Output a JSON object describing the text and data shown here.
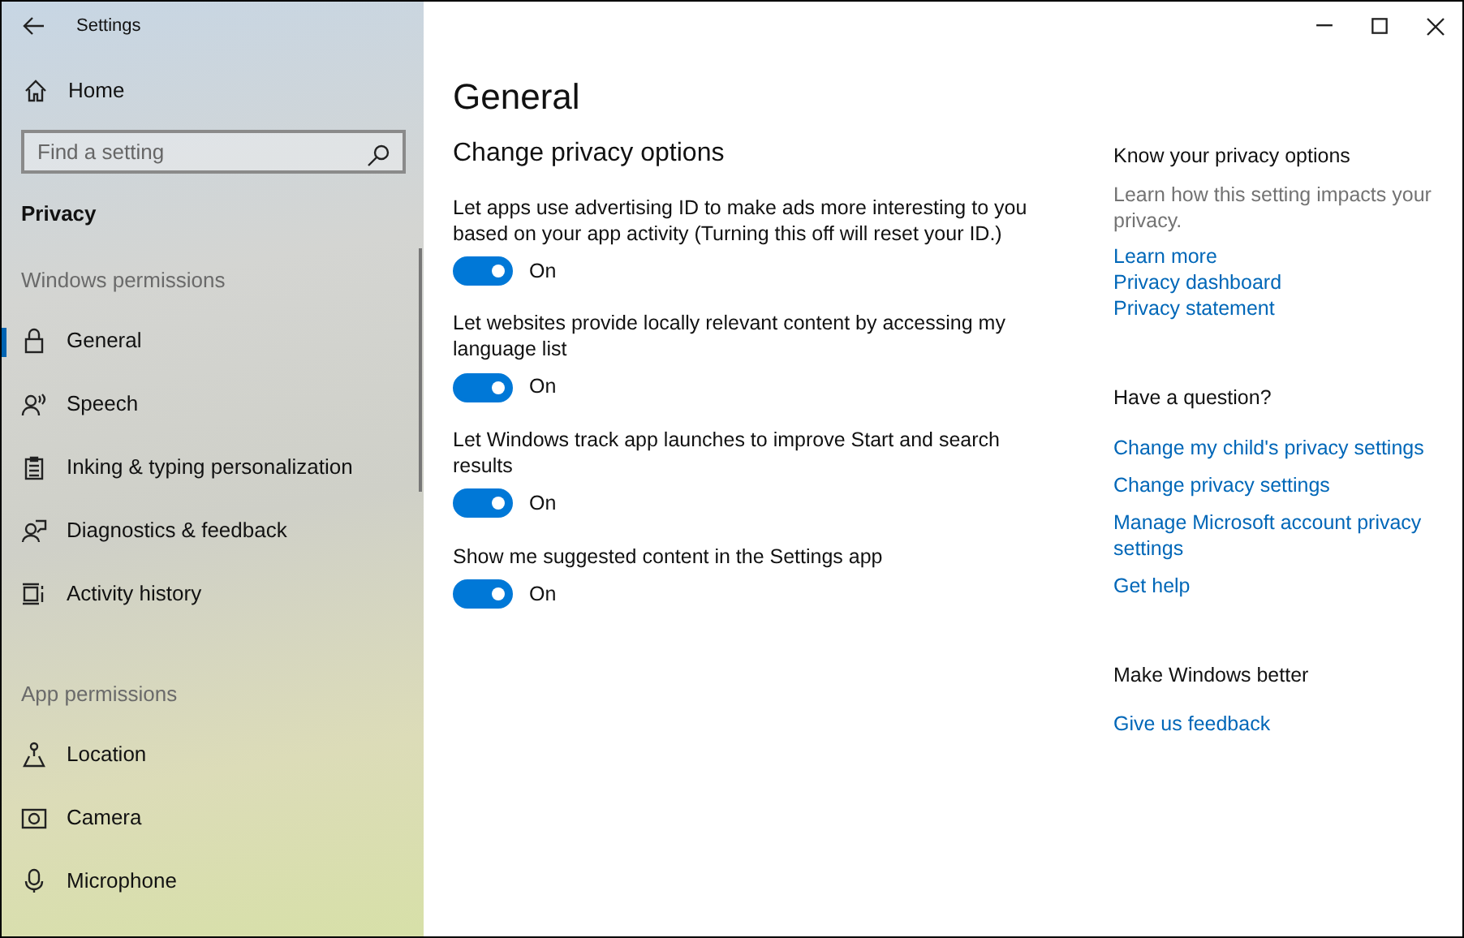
{
  "window": {
    "title": "Settings"
  },
  "sidebar": {
    "home": "Home",
    "search": {
      "placeholder": "Find a setting"
    },
    "section": "Privacy",
    "groups": [
      {
        "heading": "Windows permissions",
        "items": [
          {
            "label": "General",
            "selected": true
          },
          {
            "label": "Speech",
            "selected": false
          },
          {
            "label": "Inking & typing personalization",
            "selected": false
          },
          {
            "label": "Diagnostics & feedback",
            "selected": false
          },
          {
            "label": "Activity history",
            "selected": false
          }
        ]
      },
      {
        "heading": "App permissions",
        "items": [
          {
            "label": "Location",
            "selected": false
          },
          {
            "label": "Camera",
            "selected": false
          },
          {
            "label": "Microphone",
            "selected": false
          }
        ]
      }
    ]
  },
  "page": {
    "title": "General",
    "subtitle": "Change privacy options",
    "options": [
      {
        "description": "Let apps use advertising ID to make ads more interesting to you based on your app activity (Turning this off will reset your ID.)",
        "on": true,
        "state": "On"
      },
      {
        "description": "Let websites provide locally relevant content by accessing my language list",
        "on": true,
        "state": "On"
      },
      {
        "description": "Let Windows track app launches to improve Start and search results",
        "on": true,
        "state": "On"
      },
      {
        "description": "Show me suggested content in the Settings app",
        "on": true,
        "state": "On"
      }
    ]
  },
  "aside": [
    {
      "heading": "Know your privacy options",
      "text": "Learn how this setting impacts your privacy.",
      "links": [
        "Learn more",
        "Privacy dashboard",
        "Privacy statement"
      ]
    },
    {
      "heading": "Have a question?",
      "links": [
        "Change my child's privacy settings",
        "Change privacy settings",
        "Manage Microsoft account privacy settings",
        "Get help"
      ]
    },
    {
      "heading": "Make Windows better",
      "links": [
        "Give us feedback"
      ]
    }
  ]
}
